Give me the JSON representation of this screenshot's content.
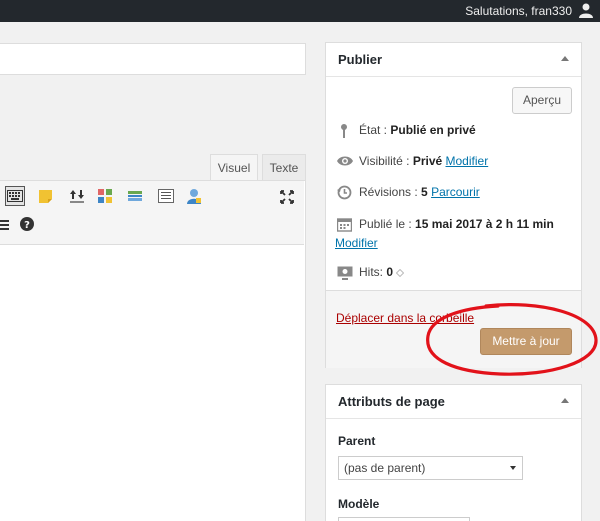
{
  "admin_bar": {
    "greeting": "Salutations, fran330",
    "avatar_icon": "user-icon"
  },
  "editor": {
    "tabs": [
      {
        "label": "Visuel"
      },
      {
        "label": "Texte"
      }
    ],
    "toolbar_icons": [
      "keyboard-shortcuts-icon",
      "sticky-note-icon",
      "transfer-icon",
      "color-blocks-icon",
      "divider-icon",
      "list-icon",
      "user-lock-icon",
      "fullscreen-icon",
      "table-icon",
      "help-icon"
    ]
  },
  "publish_box": {
    "title": "Publier",
    "preview_label": "Aperçu",
    "status": {
      "label": "État : ",
      "value": "Publié en privé"
    },
    "visibility": {
      "label": "Visibilité : ",
      "value": "Privé",
      "link": "Modifier"
    },
    "revisions": {
      "label": "Révisions : ",
      "value": "5",
      "link": "Parcourir"
    },
    "published": {
      "label": "Publié le : ",
      "value": "15 mai 2017 à 2 h 11 min",
      "link": "Modifier"
    },
    "hits": {
      "label": "Hits: ",
      "value": "0"
    },
    "trash_label": "Déplacer dans la corbeille",
    "update_label": "Mettre à jour"
  },
  "page_attributes": {
    "title": "Attributs de page",
    "parent_label": "Parent",
    "parent_value": "(pas de parent)",
    "template_label": "Modèle"
  },
  "colors": {
    "admin_bar": "#23282d",
    "update_button": "#c49a6c",
    "link": "#0073aa",
    "trash": "#aa0000",
    "annotation": "#e2121a"
  }
}
